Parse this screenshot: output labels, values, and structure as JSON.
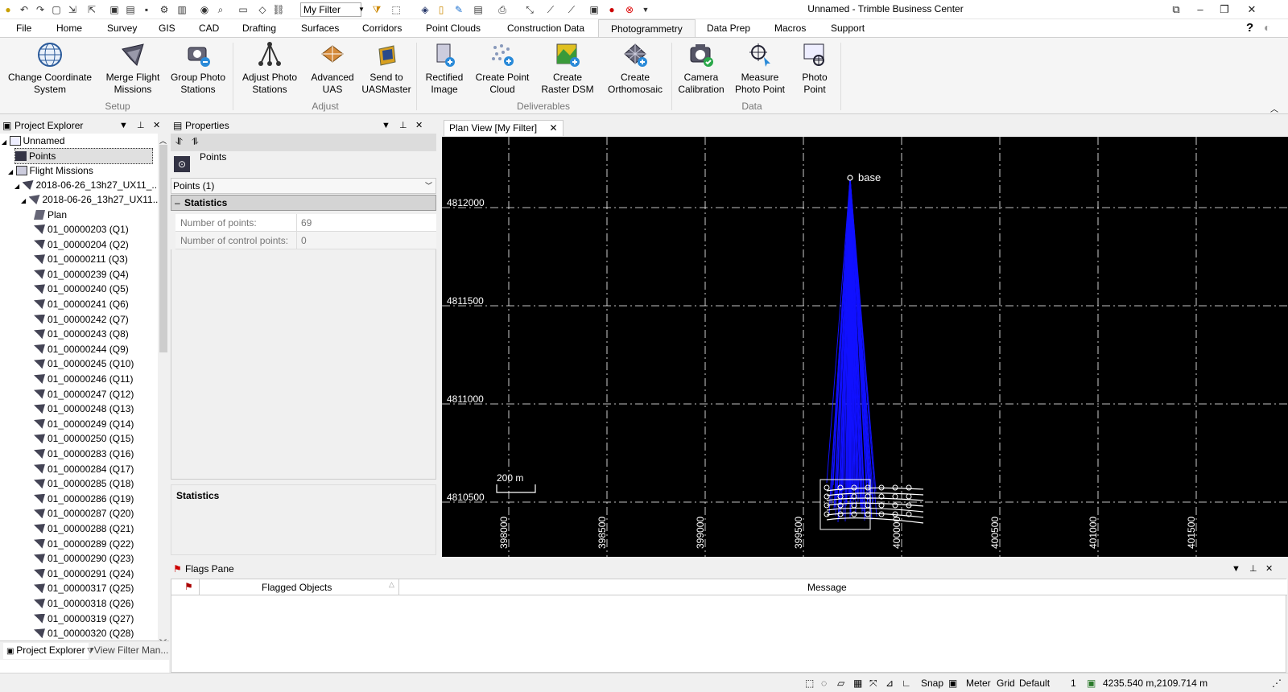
{
  "window": {
    "title": "Unnamed - Trimble Business Center"
  },
  "quick_access": {
    "filter_value": "My Filter"
  },
  "menu": [
    "File",
    "Home",
    "Survey",
    "GIS",
    "CAD",
    "Drafting",
    "Surfaces",
    "Corridors",
    "Point Clouds",
    "Construction Data",
    "Photogrammetry",
    "Data Prep",
    "Macros",
    "Support"
  ],
  "ribbon": {
    "buttons": [
      {
        "label": "Change Coordinate\nSystem",
        "icon": "globe-icon"
      },
      {
        "label": "Merge Flight\nMissions",
        "icon": "merge-flights-icon"
      },
      {
        "label": "Group Photo\nStations",
        "icon": "group-stations-icon"
      },
      {
        "label": "Adjust Photo\nStations",
        "icon": "adjust-network-icon"
      },
      {
        "label": "Advanced\nUAS",
        "icon": "advanced-uas-icon"
      },
      {
        "label": "Send to\nUASMaster",
        "icon": "send-uasmaster-icon"
      },
      {
        "label": "Rectified\nImage",
        "icon": "rectified-image-icon"
      },
      {
        "label": "Create Point\nCloud",
        "icon": "point-cloud-icon"
      },
      {
        "label": "Create\nRaster DSM",
        "icon": "raster-dsm-icon"
      },
      {
        "label": "Create\nOrthomosaic",
        "icon": "orthomosaic-icon"
      },
      {
        "label": "Camera\nCalibration",
        "icon": "camera-calibration-icon"
      },
      {
        "label": "Measure\nPhoto Point",
        "icon": "measure-photo-point-icon"
      },
      {
        "label": "Photo\nPoint",
        "icon": "photo-point-icon"
      }
    ],
    "groups": [
      "Setup",
      "Adjust",
      "Deliverables",
      "Data"
    ]
  },
  "project_explorer": {
    "title": "Project Explorer",
    "root": "Unnamed",
    "points": "Points",
    "flight_missions": "Flight Missions",
    "mission1": "2018-06-26_13h27_UX11_...",
    "mission2": "2018-06-26_13h27_UX11...",
    "plan": "Plan",
    "stations": [
      "01_00000203 (Q1)",
      "01_00000204 (Q2)",
      "01_00000211 (Q3)",
      "01_00000239 (Q4)",
      "01_00000240 (Q5)",
      "01_00000241 (Q6)",
      "01_00000242 (Q7)",
      "01_00000243 (Q8)",
      "01_00000244 (Q9)",
      "01_00000245 (Q10)",
      "01_00000246 (Q11)",
      "01_00000247 (Q12)",
      "01_00000248 (Q13)",
      "01_00000249 (Q14)",
      "01_00000250 (Q15)",
      "01_00000283 (Q16)",
      "01_00000284 (Q17)",
      "01_00000285 (Q18)",
      "01_00000286 (Q19)",
      "01_00000287 (Q20)",
      "01_00000288 (Q21)",
      "01_00000289 (Q22)",
      "01_00000290 (Q23)",
      "01_00000291 (Q24)",
      "01_00000317 (Q25)",
      "01_00000318 (Q26)",
      "01_00000319 (Q27)",
      "01_00000320 (Q28)"
    ],
    "bottom_tabs": [
      "Project Explorer",
      "View Filter Man..."
    ]
  },
  "properties": {
    "title": "Properties",
    "object_label": "Points",
    "selector": "Points (1)",
    "section": "Statistics",
    "rows": [
      {
        "name": "Number of points:",
        "value": "69"
      },
      {
        "name": "Number of control points:",
        "value": "0"
      }
    ],
    "desc_title": "Statistics"
  },
  "plan_view": {
    "tab": "Plan View [My Filter]",
    "northings": [
      "4812000",
      "4811500",
      "4811000",
      "4810500"
    ],
    "eastings": [
      "398000",
      "398500",
      "399000",
      "399500",
      "400000",
      "400500",
      "401000",
      "401500"
    ],
    "base_label": "base",
    "scale_label": "200 m",
    "colors": {
      "rays": "#1010ff",
      "background": "#000000",
      "grid": "#ffffff"
    }
  },
  "flags": {
    "title": "Flags Pane",
    "columns": [
      "Flagged Objects",
      "Message"
    ]
  },
  "status": {
    "snap": "Snap",
    "units": "Meter",
    "grid": "Grid",
    "mode": "Default",
    "count": "1",
    "coords": "4235.540 m,2109.714 m"
  }
}
